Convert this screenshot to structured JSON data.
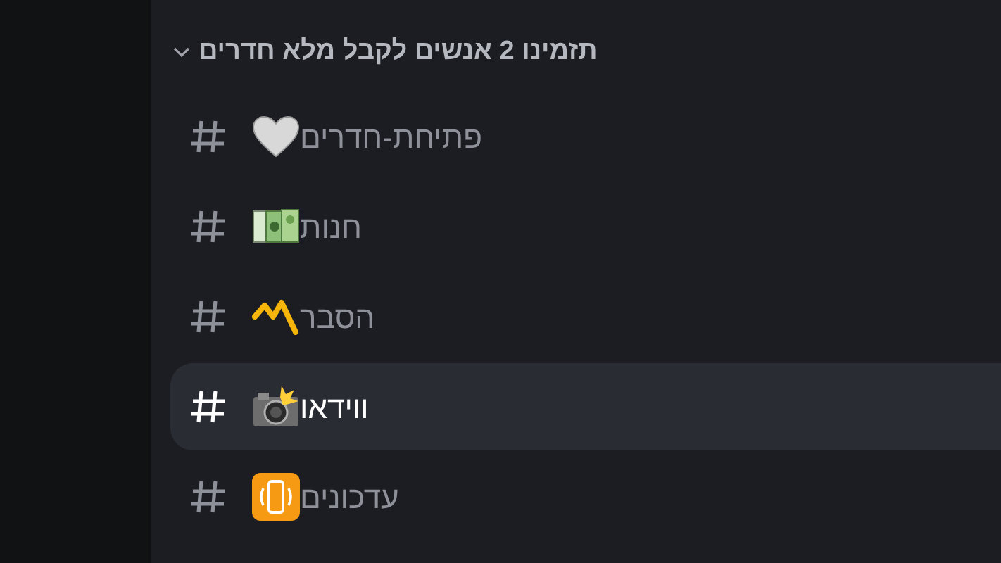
{
  "category": {
    "title": "תזמינו 2 אנשים לקבל מלא חדרים",
    "expanded": true
  },
  "channels": [
    {
      "name": "פתיחת-חדרים",
      "selected": false
    },
    {
      "name": "חנות",
      "selected": false
    },
    {
      "name": "הסבר",
      "selected": false
    },
    {
      "name": "ווידאו",
      "selected": true
    },
    {
      "name": "עדכונים",
      "selected": false
    }
  ]
}
